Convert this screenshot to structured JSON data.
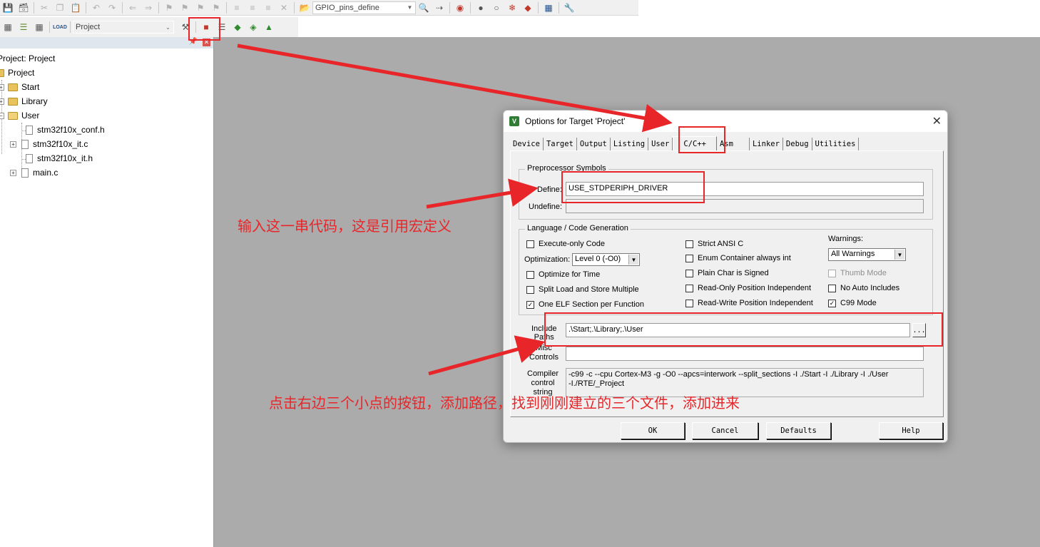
{
  "toolbar1": {
    "target_combo": "GPIO_pins_define"
  },
  "toolbar2": {
    "load_label": "LOAD",
    "project_combo": "Project"
  },
  "project_pane": {
    "root": "Project: Project",
    "project": "Project",
    "folders": [
      "Start",
      "Library",
      "User"
    ],
    "user_files": [
      "stm32f10x_conf.h",
      "stm32f10x_it.c",
      "stm32f10x_it.h",
      "main.c"
    ]
  },
  "dialog": {
    "title": "Options for Target 'Project'",
    "tabs": [
      "Device",
      "Target",
      "Output",
      "Listing",
      "User",
      "C/C++",
      "Asm",
      "Linker",
      "Debug",
      "Utilities"
    ],
    "active_tab": "C/C++",
    "preprocessor": {
      "group_label": "Preprocessor Symbols",
      "define_label": "Define:",
      "define_value": "USE_STDPERIPH_DRIVER",
      "undefine_label": "Undefine:",
      "undefine_value": ""
    },
    "language": {
      "group_label": "Language / Code Generation",
      "execute_only": "Execute-only Code",
      "optimization_label": "Optimization:",
      "optimization_value": "Level 0 (-O0)",
      "optimize_time": "Optimize for Time",
      "split_load": "Split Load and Store Multiple",
      "one_elf": "One ELF Section per Function",
      "strict_ansi": "Strict ANSI C",
      "enum_container": "Enum Container always int",
      "plain_char": "Plain Char is Signed",
      "ro_pi": "Read-Only Position Independent",
      "rw_pi": "Read-Write Position Independent",
      "warnings_label": "Warnings:",
      "warnings_value": "All Warnings",
      "thumb_mode": "Thumb Mode",
      "no_auto_includes": "No Auto Includes",
      "c99_mode": "C99 Mode"
    },
    "include_paths_label": "Include\nPaths",
    "include_paths_value": ".\\Start;.\\Library;.\\User",
    "browse_label": "...",
    "misc_label": "Misc\nControls",
    "misc_value": "",
    "compiler_label": "Compiler\ncontrol\nstring",
    "compiler_value": "-c99 -c --cpu Cortex-M3 -g -O0 --apcs=interwork --split_sections -I ./Start -I ./Library -I ./User\n-I./RTE/_Project",
    "buttons": {
      "ok": "OK",
      "cancel": "Cancel",
      "defaults": "Defaults",
      "help": "Help"
    }
  },
  "annotations": {
    "define_note": "输入这一串代码，这是引用宏定义",
    "paths_note": "点击右边三个小点的按钮，添加路径，找到刚刚建立的三个文件，添加进来"
  },
  "colors": {
    "annotation": "#e8262a",
    "workspace": "#ababab",
    "dialog_bg": "#f0f0f0"
  }
}
